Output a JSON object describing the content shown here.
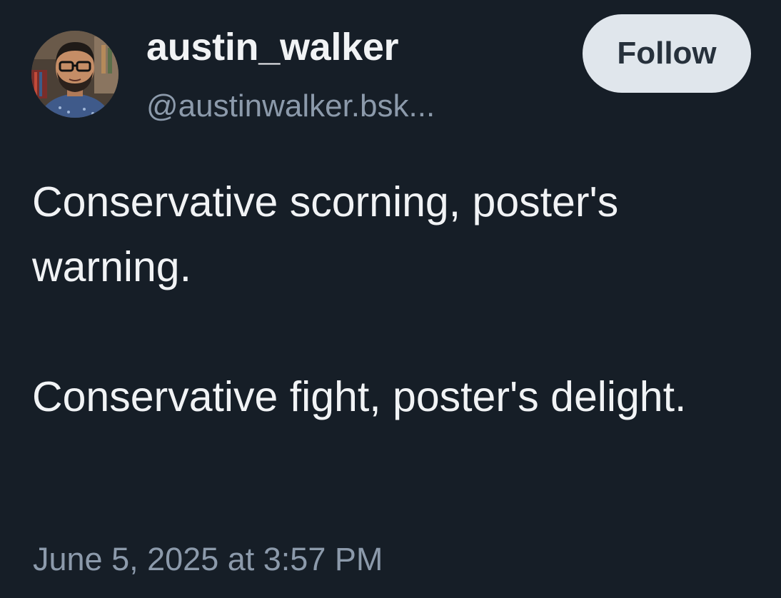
{
  "post": {
    "author": {
      "display_name": "austin_walker",
      "handle": "@austinwalker.bsk..."
    },
    "follow_label": "Follow",
    "text_paragraphs": [
      "Conservative scorning, poster's warning.",
      "Conservative fight, poster's delight."
    ],
    "timestamp": "June 5, 2025 at 3:57 PM"
  },
  "colors": {
    "background": "#161e27",
    "primary_text": "#f1f3f5",
    "secondary_text": "#8c9aab",
    "follow_button_bg": "#e0e6ec",
    "follow_button_text": "#27313c"
  },
  "icons": {
    "avatar": "user-avatar-photo"
  }
}
